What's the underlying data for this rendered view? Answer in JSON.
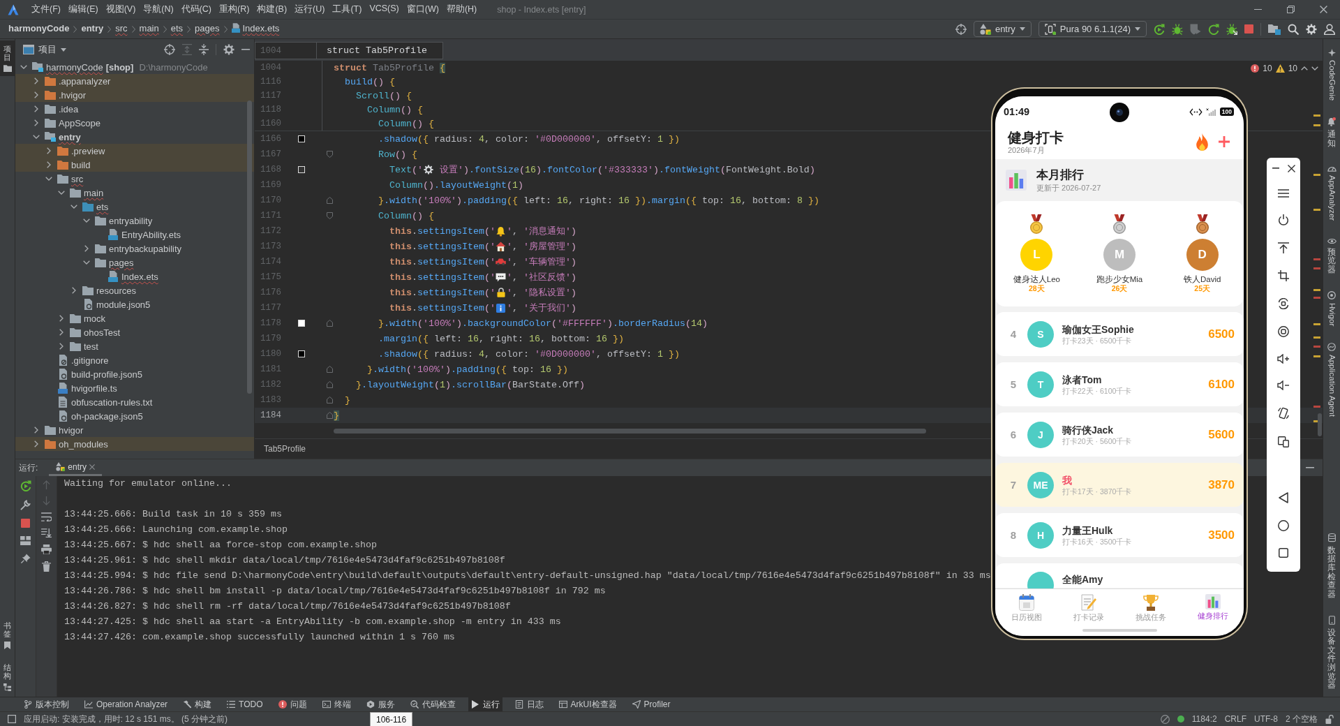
{
  "menu_bar": {
    "items": [
      "文件(F)",
      "编辑(E)",
      "视图(V)",
      "导航(N)",
      "代码(C)",
      "重构(R)",
      "构建(B)",
      "运行(U)",
      "工具(T)",
      "VCS(S)",
      "窗口(W)",
      "帮助(H)"
    ],
    "title": "shop - Index.ets [entry]"
  },
  "nav_bar": {
    "breadcrumbs": [
      {
        "label": "harmonyCode",
        "kind": "module",
        "squiggle": false
      },
      {
        "label": "entry",
        "kind": "module",
        "squiggle": false
      },
      {
        "label": "src",
        "kind": "folder",
        "squiggle": true
      },
      {
        "label": "main",
        "kind": "folder",
        "squiggle": true
      },
      {
        "label": "ets",
        "kind": "folder",
        "squiggle": true
      },
      {
        "label": "pages",
        "kind": "folder",
        "squiggle": true
      },
      {
        "label": "Index.ets",
        "kind": "file",
        "squiggle": true
      }
    ],
    "run_config": "entry",
    "device": "Pura 90 6.1.1(24)",
    "actions": [
      {
        "kind": "run",
        "disabled": false
      },
      {
        "kind": "debug",
        "disabled": false
      },
      {
        "kind": "profile",
        "disabled": true
      },
      {
        "kind": "restart",
        "disabled": false
      },
      {
        "kind": "attach",
        "disabled": false
      },
      {
        "kind": "stop",
        "disabled": false
      }
    ]
  },
  "left_strip": {
    "top": [
      {
        "label": "项目",
        "kind": "project",
        "selected": true
      }
    ],
    "bottom": [
      {
        "label": "书签",
        "kind": "bookmark",
        "selected": false
      },
      {
        "label": "结构",
        "kind": "structure",
        "selected": false
      }
    ]
  },
  "project": {
    "title": "项目",
    "tree": [
      {
        "label": "harmonyCode",
        "tag": "[shop]",
        "path": "D:\\harmonyCode",
        "kind": "project",
        "expanded": true,
        "squiggle": true,
        "children": [
          {
            "label": ".appanalyzer",
            "kind": "excluded",
            "expanded": false,
            "squiggle": false
          },
          {
            "label": ".hvigor",
            "kind": "excluded",
            "expanded": false,
            "squiggle": false
          },
          {
            "label": ".idea",
            "kind": "folder",
            "expanded": false,
            "squiggle": false
          },
          {
            "label": "AppScope",
            "kind": "folder",
            "expanded": false,
            "squiggle": false
          },
          {
            "label": "entry",
            "kind": "module",
            "expanded": true,
            "squiggle": true,
            "children": [
              {
                "label": ".preview",
                "kind": "excluded",
                "expanded": false,
                "squiggle": false
              },
              {
                "label": "build",
                "kind": "excluded",
                "expanded": false,
                "squiggle": false
              },
              {
                "label": "src",
                "kind": "folder",
                "expanded": true,
                "squiggle": true,
                "children": [
                  {
                    "label": "main",
                    "kind": "folder",
                    "expanded": true,
                    "squiggle": true,
                    "children": [
                      {
                        "label": "ets",
                        "kind": "source",
                        "expanded": true,
                        "squiggle": true,
                        "children": [
                          {
                            "label": "entryability",
                            "kind": "folder",
                            "expanded": true,
                            "squiggle": false,
                            "children": [
                              {
                                "label": "EntryAbility.ets",
                                "kind": "ets-file",
                                "squiggle": false
                              }
                            ]
                          },
                          {
                            "label": "entrybackupability",
                            "kind": "folder",
                            "expanded": false,
                            "squiggle": false
                          },
                          {
                            "label": "pages",
                            "kind": "folder",
                            "expanded": true,
                            "squiggle": true,
                            "children": [
                              {
                                "label": "Index.ets",
                                "kind": "ets-file",
                                "squiggle": true
                              }
                            ]
                          }
                        ]
                      },
                      {
                        "label": "resources",
                        "kind": "folder",
                        "expanded": false,
                        "squiggle": false
                      },
                      {
                        "label": "module.json5",
                        "kind": "json-file",
                        "squiggle": false
                      }
                    ]
                  },
                  {
                    "label": "mock",
                    "kind": "folder",
                    "expanded": false,
                    "squiggle": false
                  },
                  {
                    "label": "ohosTest",
                    "kind": "folder",
                    "expanded": false,
                    "squiggle": false
                  },
                  {
                    "label": "test",
                    "kind": "folder",
                    "expanded": false,
                    "squiggle": false
                  }
                ]
              },
              {
                "label": ".gitignore",
                "kind": "ignore-file",
                "squiggle": false
              },
              {
                "label": "build-profile.json5",
                "kind": "json-file",
                "squiggle": false
              },
              {
                "label": "hvigorfile.ts",
                "kind": "ts-file",
                "squiggle": false
              },
              {
                "label": "obfuscation-rules.txt",
                "kind": "text-file",
                "squiggle": false
              },
              {
                "label": "oh-package.json5",
                "kind": "json-file",
                "squiggle": false
              }
            ]
          },
          {
            "label": "hvigor",
            "kind": "folder",
            "expanded": false,
            "squiggle": false
          },
          {
            "label": "oh_modules",
            "kind": "excluded",
            "expanded": false,
            "squiggle": false
          }
        ]
      }
    ]
  },
  "editor": {
    "context": {
      "number": "1004",
      "code": "struct Tab5Profile"
    },
    "sticky": [
      {
        "number": "1004",
        "tokens": [
          {
            "text": "struct ",
            "kind": "keyword"
          },
          {
            "text": "Tab5Profile ",
            "kind": "dim"
          },
          {
            "text": "{",
            "kind": "match"
          }
        ]
      },
      {
        "number": "1116",
        "tokens": [
          {
            "text": "  build",
            "kind": "function"
          },
          {
            "text": "()",
            "kind": "paren"
          },
          {
            "text": " {",
            "kind": "bracket"
          }
        ]
      },
      {
        "number": "1117",
        "tokens": [
          {
            "text": "    Scroll",
            "kind": "component"
          },
          {
            "text": "()",
            "kind": "paren"
          },
          {
            "text": " {",
            "kind": "bracket"
          }
        ]
      },
      {
        "number": "1118",
        "tokens": [
          {
            "text": "      Column",
            "kind": "component"
          },
          {
            "text": "()",
            "kind": "paren"
          },
          {
            "text": " {",
            "kind": "bracket"
          }
        ]
      },
      {
        "number": "1160",
        "tokens": [
          {
            "text": "        Column",
            "kind": "component"
          },
          {
            "text": "()",
            "kind": "paren"
          },
          {
            "text": " {",
            "kind": "bracket"
          }
        ]
      }
    ],
    "lines": [
      {
        "number": "1166",
        "current": false,
        "swatch": {
          "color": "#000000"
        },
        "tokens": [
          {
            "text": "        .shadow",
            "kind": "function"
          },
          {
            "text": "({ ",
            "kind": "bracket"
          },
          {
            "text": "radius: ",
            "kind": "plain"
          },
          {
            "text": "4",
            "kind": "number"
          },
          {
            "text": ", color: ",
            "kind": "plain"
          },
          {
            "text": "'#0D000000'",
            "kind": "string"
          },
          {
            "text": ", offsetY: ",
            "kind": "plain"
          },
          {
            "text": "1",
            "kind": "number"
          },
          {
            "text": " })",
            "kind": "bracket"
          }
        ]
      },
      {
        "number": "1167",
        "current": false,
        "fold": {
          "kind": "start"
        },
        "tokens": [
          {
            "text": "        Row",
            "kind": "component"
          },
          {
            "text": "()",
            "kind": "paren"
          },
          {
            "text": " {",
            "kind": "bracket"
          }
        ]
      },
      {
        "number": "1168",
        "current": false,
        "swatch": {
          "color": "#333333"
        },
        "tokens": [
          {
            "text": "          Text",
            "kind": "component"
          },
          {
            "text": "(",
            "kind": "paren"
          },
          {
            "text": "'",
            "kind": "string"
          },
          {
            "kind": "gear"
          },
          {
            "text": " 设置'",
            "kind": "string"
          },
          {
            "text": ")",
            "kind": "paren"
          },
          {
            "text": ".fontSize",
            "kind": "function"
          },
          {
            "text": "(",
            "kind": "paren"
          },
          {
            "text": "16",
            "kind": "number"
          },
          {
            "text": ")",
            "kind": "paren"
          },
          {
            "text": ".fontColor",
            "kind": "function"
          },
          {
            "text": "(",
            "kind": "paren"
          },
          {
            "text": "'#333333'",
            "kind": "string"
          },
          {
            "text": ")",
            "kind": "paren"
          },
          {
            "text": ".fontWeight",
            "kind": "function"
          },
          {
            "text": "(",
            "kind": "paren"
          },
          {
            "text": "FontWeight.Bold",
            "kind": "plain"
          },
          {
            "text": ")",
            "kind": "paren"
          }
        ]
      },
      {
        "number": "1169",
        "current": false,
        "tokens": [
          {
            "text": "          Column",
            "kind": "component"
          },
          {
            "text": "()",
            "kind": "paren"
          },
          {
            "text": ".layoutWeight",
            "kind": "function"
          },
          {
            "text": "(",
            "kind": "paren"
          },
          {
            "text": "1",
            "kind": "number"
          },
          {
            "text": ")",
            "kind": "paren"
          }
        ]
      },
      {
        "number": "1170",
        "current": false,
        "fold": {
          "kind": "end"
        },
        "tokens": [
          {
            "text": "        }",
            "kind": "bracket"
          },
          {
            "text": ".width",
            "kind": "function"
          },
          {
            "text": "(",
            "kind": "paren"
          },
          {
            "text": "'100%'",
            "kind": "string"
          },
          {
            "text": ")",
            "kind": "paren"
          },
          {
            "text": ".padding",
            "kind": "function"
          },
          {
            "text": "({ ",
            "kind": "bracket"
          },
          {
            "text": "left: ",
            "kind": "plain"
          },
          {
            "text": "16",
            "kind": "number"
          },
          {
            "text": ", right: ",
            "kind": "plain"
          },
          {
            "text": "16",
            "kind": "number"
          },
          {
            "text": " })",
            "kind": "bracket"
          },
          {
            "text": ".margin",
            "kind": "function"
          },
          {
            "text": "({ ",
            "kind": "bracket"
          },
          {
            "text": "top: ",
            "kind": "plain"
          },
          {
            "text": "16",
            "kind": "number"
          },
          {
            "text": ", bottom: ",
            "kind": "plain"
          },
          {
            "text": "8",
            "kind": "number"
          },
          {
            "text": " })",
            "kind": "bracket"
          }
        ]
      },
      {
        "number": "1171",
        "current": false,
        "fold": {
          "kind": "start"
        },
        "tokens": [
          {
            "text": "        Column",
            "kind": "component"
          },
          {
            "text": "()",
            "kind": "paren"
          },
          {
            "text": " {",
            "kind": "bracket"
          }
        ]
      },
      {
        "number": "1172",
        "current": false,
        "tokens": [
          {
            "text": "          this",
            "kind": "keyword"
          },
          {
            "text": ".",
            "kind": "plain"
          },
          {
            "text": "settingsItem",
            "kind": "function"
          },
          {
            "text": "(",
            "kind": "paren"
          },
          {
            "text": "'",
            "kind": "string"
          },
          {
            "kind": "bell"
          },
          {
            "text": "'",
            "kind": "string"
          },
          {
            "text": ", ",
            "kind": "plain"
          },
          {
            "text": "'消息通知'",
            "kind": "string"
          },
          {
            "text": ")",
            "kind": "paren"
          }
        ]
      },
      {
        "number": "1173",
        "current": false,
        "tokens": [
          {
            "text": "          this",
            "kind": "keyword"
          },
          {
            "text": ".",
            "kind": "plain"
          },
          {
            "text": "settingsItem",
            "kind": "function"
          },
          {
            "text": "(",
            "kind": "paren"
          },
          {
            "text": "'",
            "kind": "string"
          },
          {
            "kind": "house"
          },
          {
            "text": "'",
            "kind": "string"
          },
          {
            "text": ", ",
            "kind": "plain"
          },
          {
            "text": "'房屋管理'",
            "kind": "string"
          },
          {
            "text": ")",
            "kind": "paren"
          }
        ]
      },
      {
        "number": "1174",
        "current": false,
        "tokens": [
          {
            "text": "          this",
            "kind": "keyword"
          },
          {
            "text": ".",
            "kind": "plain"
          },
          {
            "text": "settingsItem",
            "kind": "function"
          },
          {
            "text": "(",
            "kind": "paren"
          },
          {
            "text": "'",
            "kind": "string"
          },
          {
            "kind": "car"
          },
          {
            "text": "'",
            "kind": "string"
          },
          {
            "text": ", ",
            "kind": "plain"
          },
          {
            "text": "'车辆管理'",
            "kind": "string"
          },
          {
            "text": ")",
            "kind": "paren"
          }
        ]
      },
      {
        "number": "1175",
        "current": false,
        "tokens": [
          {
            "text": "          this",
            "kind": "keyword"
          },
          {
            "text": ".",
            "kind": "plain"
          },
          {
            "text": "settingsItem",
            "kind": "function"
          },
          {
            "text": "(",
            "kind": "paren"
          },
          {
            "text": "'",
            "kind": "string"
          },
          {
            "kind": "speech"
          },
          {
            "text": "'",
            "kind": "string"
          },
          {
            "text": ", ",
            "kind": "plain"
          },
          {
            "text": "'社区反馈'",
            "kind": "string"
          },
          {
            "text": ")",
            "kind": "paren"
          }
        ]
      },
      {
        "number": "1176",
        "current": false,
        "tokens": [
          {
            "text": "          this",
            "kind": "keyword"
          },
          {
            "text": ".",
            "kind": "plain"
          },
          {
            "text": "settingsItem",
            "kind": "function"
          },
          {
            "text": "(",
            "kind": "paren"
          },
          {
            "text": "'",
            "kind": "string"
          },
          {
            "kind": "lock"
          },
          {
            "text": "'",
            "kind": "string"
          },
          {
            "text": ", ",
            "kind": "plain"
          },
          {
            "text": "'隐私设置'",
            "kind": "string"
          },
          {
            "text": ")",
            "kind": "paren"
          }
        ]
      },
      {
        "number": "1177",
        "current": false,
        "tokens": [
          {
            "text": "          this",
            "kind": "keyword"
          },
          {
            "text": ".",
            "kind": "plain"
          },
          {
            "text": "settingsItem",
            "kind": "function"
          },
          {
            "text": "(",
            "kind": "paren"
          },
          {
            "text": "'",
            "kind": "string"
          },
          {
            "kind": "info"
          },
          {
            "text": "'",
            "kind": "string"
          },
          {
            "text": ", ",
            "kind": "plain"
          },
          {
            "text": "'关于我们'",
            "kind": "string"
          },
          {
            "text": ")",
            "kind": "paren"
          }
        ]
      },
      {
        "number": "1178",
        "current": false,
        "swatch": {
          "color": "#ffffff"
        },
        "fold": {
          "kind": "end"
        },
        "tokens": [
          {
            "text": "        }",
            "kind": "bracket"
          },
          {
            "text": ".width",
            "kind": "function"
          },
          {
            "text": "(",
            "kind": "paren"
          },
          {
            "text": "'100%'",
            "kind": "string"
          },
          {
            "text": ")",
            "kind": "paren"
          },
          {
            "text": ".backgroundColor",
            "kind": "function"
          },
          {
            "text": "(",
            "kind": "paren"
          },
          {
            "text": "'#FFFFFF'",
            "kind": "string"
          },
          {
            "text": ")",
            "kind": "paren"
          },
          {
            "text": ".borderRadius",
            "kind": "function"
          },
          {
            "text": "(",
            "kind": "paren"
          },
          {
            "text": "14",
            "kind": "number"
          },
          {
            "text": ")",
            "kind": "paren"
          }
        ]
      },
      {
        "number": "1179",
        "current": false,
        "tokens": [
          {
            "text": "        .margin",
            "kind": "function"
          },
          {
            "text": "({ ",
            "kind": "bracket"
          },
          {
            "text": "left: ",
            "kind": "plain"
          },
          {
            "text": "16",
            "kind": "number"
          },
          {
            "text": ", right: ",
            "kind": "plain"
          },
          {
            "text": "16",
            "kind": "number"
          },
          {
            "text": ", bottom: ",
            "kind": "plain"
          },
          {
            "text": "16",
            "kind": "number"
          },
          {
            "text": " })",
            "kind": "bracket"
          }
        ]
      },
      {
        "number": "1180",
        "current": false,
        "swatch": {
          "color": "#000000"
        },
        "tokens": [
          {
            "text": "        .shadow",
            "kind": "function"
          },
          {
            "text": "({ ",
            "kind": "bracket"
          },
          {
            "text": "radius: ",
            "kind": "plain"
          },
          {
            "text": "4",
            "kind": "number"
          },
          {
            "text": ", color: ",
            "kind": "plain"
          },
          {
            "text": "'#0D000000'",
            "kind": "string"
          },
          {
            "text": ", offsetY: ",
            "kind": "plain"
          },
          {
            "text": "1",
            "kind": "number"
          },
          {
            "text": " })",
            "kind": "bracket"
          }
        ]
      },
      {
        "number": "1181",
        "current": false,
        "fold": {
          "kind": "end"
        },
        "tokens": [
          {
            "text": "      }",
            "kind": "bracket"
          },
          {
            "text": ".width",
            "kind": "function"
          },
          {
            "text": "(",
            "kind": "paren"
          },
          {
            "text": "'100%'",
            "kind": "string"
          },
          {
            "text": ")",
            "kind": "paren"
          },
          {
            "text": ".padding",
            "kind": "function"
          },
          {
            "text": "({ ",
            "kind": "bracket"
          },
          {
            "text": "top: ",
            "kind": "plain"
          },
          {
            "text": "16",
            "kind": "number"
          },
          {
            "text": " })",
            "kind": "bracket"
          }
        ]
      },
      {
        "number": "1182",
        "current": false,
        "fold": {
          "kind": "end"
        },
        "tokens": [
          {
            "text": "    }",
            "kind": "bracket"
          },
          {
            "text": ".layoutWeight",
            "kind": "function"
          },
          {
            "text": "(",
            "kind": "paren"
          },
          {
            "text": "1",
            "kind": "number"
          },
          {
            "text": ")",
            "kind": "paren"
          },
          {
            "text": ".scrollBar",
            "kind": "function"
          },
          {
            "text": "(",
            "kind": "paren"
          },
          {
            "text": "BarState.Off",
            "kind": "plain"
          },
          {
            "text": ")",
            "kind": "paren"
          }
        ]
      },
      {
        "number": "1183",
        "current": false,
        "fold": {
          "kind": "end"
        },
        "tokens": [
          {
            "text": "  }",
            "kind": "bracket"
          }
        ]
      },
      {
        "number": "1184",
        "current": true,
        "fold": {
          "kind": "end"
        },
        "tokens": [
          {
            "text": "}",
            "kind": "match"
          }
        ]
      }
    ],
    "footer": "Tab5Profile",
    "problems": {
      "errors": "10",
      "warnings": "10"
    },
    "markers": [
      {
        "kind": "warning"
      },
      {
        "kind": "warning"
      },
      {
        "kind": "warning"
      },
      {
        "kind": "warning"
      },
      {
        "kind": "error"
      },
      {
        "kind": "error"
      },
      {
        "kind": "warning"
      },
      {
        "kind": "error"
      },
      {
        "kind": "warning"
      },
      {
        "kind": "warning"
      },
      {
        "kind": "error"
      },
      {
        "kind": "warning"
      },
      {
        "kind": "error"
      },
      {
        "kind": "warning"
      }
    ]
  },
  "run": {
    "label": "运行:",
    "tab": "entry",
    "tools": {
      "primary": [
        {
          "kind": "rerun",
          "disabled": false
        },
        {
          "kind": "wrench",
          "disabled": false
        },
        {
          "kind": "stop",
          "disabled": false
        },
        {
          "kind": "layout",
          "disabled": false
        },
        {
          "kind": "pin",
          "disabled": false
        }
      ],
      "secondary": [
        {
          "kind": "up",
          "disabled": true
        },
        {
          "kind": "down",
          "disabled": true
        },
        {
          "kind": "wrap",
          "disabled": false
        },
        {
          "kind": "scroll-end",
          "disabled": false
        },
        {
          "kind": "print",
          "disabled": false
        },
        {
          "kind": "trash",
          "disabled": false
        }
      ]
    },
    "output": [
      [
        "Waiting for emulator online..."
      ],
      [
        "13:44:25.666: Build task in 10 s 359 ms",
        "13:44:25.666: Launching com.example.shop",
        "13:44:25.667: $ hdc shell aa force-stop com.example.shop",
        "13:44:25.961: $ hdc shell mkdir data/local/tmp/7616e4e5473d4faf9c6251b497b8108f",
        "13:44:25.994: $ hdc file send D:\\harmonyCode\\entry\\build\\default\\outputs\\default\\entry-default-unsigned.hap \"data/local/tmp/7616e4e5473d4faf9c6251b497b8108f\" in 33 ms",
        "13:44:26.786: $ hdc shell bm install -p data/local/tmp/7616e4e5473d4faf9c6251b497b8108f in 792 ms",
        "13:44:26.827: $ hdc shell rm -rf data/local/tmp/7616e4e5473d4faf9c6251b497b8108f",
        "13:44:27.425: $ hdc shell aa start -a EntryAbility -b com.example.shop -m entry in 433 ms",
        "13:44:27.426: com.example.shop successfully launched within 1 s 760 ms"
      ]
    ]
  },
  "tool_windows": [
    {
      "label": "版本控制",
      "kind": "vcs",
      "selected": false
    },
    {
      "label": "Operation Analyzer",
      "kind": "analyzer",
      "selected": false
    },
    {
      "label": "构建",
      "kind": "build",
      "selected": false
    },
    {
      "label": "TODO",
      "kind": "todo",
      "selected": false
    },
    {
      "label": "问题",
      "kind": "problems",
      "selected": false
    },
    {
      "label": "终端",
      "kind": "terminal",
      "selected": false
    },
    {
      "label": "服务",
      "kind": "services",
      "selected": false
    },
    {
      "label": "代码检查",
      "kind": "inspect",
      "selected": false
    },
    {
      "label": "运行",
      "kind": "run",
      "selected": true
    },
    {
      "label": "日志",
      "kind": "log",
      "selected": false
    },
    {
      "label": "ArkUI检查器",
      "kind": "arkui",
      "selected": false
    },
    {
      "label": "Profiler",
      "kind": "profiler",
      "selected": false
    }
  ],
  "status_bar": {
    "message": "应用启动: 安装完成，用时: 12 s 151 ms。 (5 分钟之前)",
    "tooltip": "106-116",
    "position": "1184:2",
    "line_separator": "CRLF",
    "encoding": "UTF-8",
    "indent": "2 个空格"
  },
  "right_strip": {
    "top": [
      {
        "label": "CodeGenie",
        "kind": "genie"
      },
      {
        "label": "通知",
        "kind": "bell"
      },
      {
        "label": "AppAnalyzer",
        "kind": "analyzer"
      },
      {
        "label": "预览器",
        "kind": "eye"
      },
      {
        "label": "Hvigor",
        "kind": "hvigor"
      },
      {
        "label": "Application Agent",
        "kind": "agent"
      }
    ],
    "bottom": [
      {
        "label": "数据库检查器",
        "kind": "database"
      },
      {
        "label": "设备文件浏览器",
        "kind": "device"
      }
    ]
  },
  "emulator": {
    "status_bar": {
      "time": "01:49",
      "battery": "100"
    },
    "app": {
      "title": "健身打卡",
      "subtitle": "2026年7月",
      "section": {
        "title": "本月排行",
        "updated": "更新于 2026-07-27"
      },
      "podium": [
        {
          "initial": "L",
          "name": "健身达人Leo",
          "days": "28天",
          "kind": "gold",
          "color": "#ffd400"
        },
        {
          "initial": "M",
          "name": "跑步少女Mia",
          "days": "26天",
          "kind": "silver",
          "color": "#bdbdbd"
        },
        {
          "initial": "D",
          "name": "铁人David",
          "days": "25天",
          "kind": "bronze",
          "color": "#cd7f32"
        }
      ],
      "ranking": [
        {
          "kind": "full",
          "rank": "4",
          "initial": "S",
          "name": "瑜伽女王Sophie",
          "detail": "打卡23天 · 6500千卡",
          "score": "6500",
          "me": false
        },
        {
          "kind": "full",
          "rank": "5",
          "initial": "T",
          "name": "泳者Tom",
          "detail": "打卡22天 · 6100千卡",
          "score": "6100",
          "me": false
        },
        {
          "kind": "full",
          "rank": "6",
          "initial": "J",
          "name": "骑行侠Jack",
          "detail": "打卡20天 · 5600千卡",
          "score": "5600",
          "me": false
        },
        {
          "kind": "full",
          "rank": "7",
          "initial": "ME",
          "name": "我",
          "detail": "打卡17天 · 3870千卡",
          "score": "3870",
          "me": true
        },
        {
          "kind": "full",
          "rank": "8",
          "initial": "H",
          "name": "力量王Hulk",
          "detail": "打卡16天 · 3500千卡",
          "score": "3500",
          "me": false
        },
        {
          "kind": "partial",
          "name": "全能Amy",
          "me": false
        }
      ],
      "tabs": [
        {
          "label": "日历视图",
          "kind": "calendar",
          "selected": false
        },
        {
          "label": "打卡记录",
          "kind": "memo",
          "selected": false
        },
        {
          "label": "挑战任务",
          "kind": "trophy",
          "selected": false
        },
        {
          "label": "健身排行",
          "kind": "chart",
          "selected": true
        }
      ]
    }
  }
}
